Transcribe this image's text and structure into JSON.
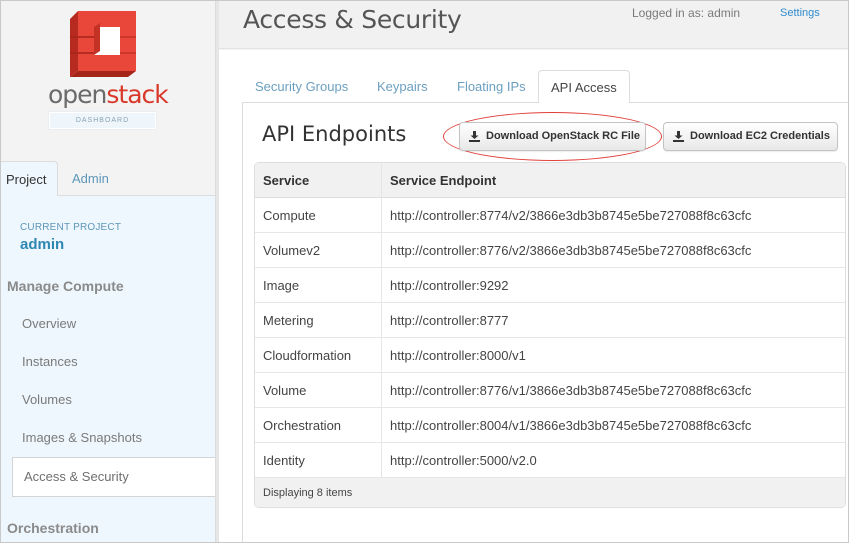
{
  "brand": {
    "logo_word_open": "open",
    "logo_word_stack": "stack",
    "badge": "DASHBOARD",
    "colors": {
      "red": "#d8392b",
      "link": "#2f8bd0"
    }
  },
  "header": {
    "title": "Access & Security",
    "logged_in": "Logged in as: admin",
    "settings": "Settings"
  },
  "sidebar": {
    "tabs": [
      {
        "label": "Project",
        "active": true
      },
      {
        "label": "Admin",
        "active": false
      }
    ],
    "current_project_label": "CURRENT PROJECT",
    "current_project_name": "admin",
    "sections": [
      {
        "title": "Manage Compute",
        "items": [
          {
            "label": "Overview"
          },
          {
            "label": "Instances"
          },
          {
            "label": "Volumes"
          },
          {
            "label": "Images & Snapshots"
          },
          {
            "label": "Access & Security",
            "active": true
          }
        ]
      },
      {
        "title": "Orchestration",
        "items": []
      }
    ]
  },
  "main": {
    "tabs": [
      {
        "label": "Security Groups"
      },
      {
        "label": "Keypairs"
      },
      {
        "label": "Floating IPs"
      },
      {
        "label": "API Access",
        "active": true
      }
    ],
    "panel_title": "API Endpoints",
    "buttons": {
      "download_rc": "Download OpenStack RC File",
      "download_ec2": "Download EC2 Credentials"
    },
    "table": {
      "columns": [
        "Service",
        "Service Endpoint"
      ],
      "rows": [
        {
          "service": "Compute",
          "endpoint": "http://controller:8774/v2/3866e3db3b8745e5be727088f8c63cfc"
        },
        {
          "service": "Volumev2",
          "endpoint": "http://controller:8776/v2/3866e3db3b8745e5be727088f8c63cfc"
        },
        {
          "service": "Image",
          "endpoint": "http://controller:9292"
        },
        {
          "service": "Metering",
          "endpoint": "http://controller:8777"
        },
        {
          "service": "Cloudformation",
          "endpoint": "http://controller:8000/v1"
        },
        {
          "service": "Volume",
          "endpoint": "http://controller:8776/v1/3866e3db3b8745e5be727088f8c63cfc"
        },
        {
          "service": "Orchestration",
          "endpoint": "http://controller:8004/v1/3866e3db3b8745e5be727088f8c63cfc"
        },
        {
          "service": "Identity",
          "endpoint": "http://controller:5000/v2.0"
        }
      ],
      "footer": "Displaying 8 items"
    }
  }
}
